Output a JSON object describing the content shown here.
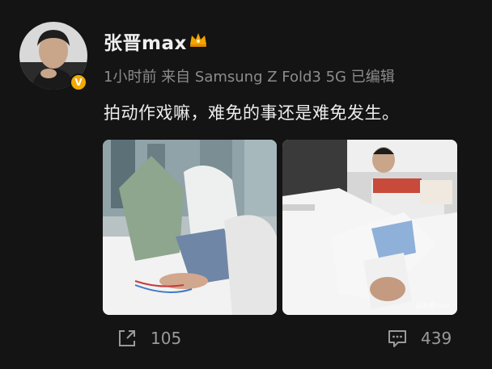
{
  "user": {
    "name": "张晋max",
    "verified_badge": "V"
  },
  "post": {
    "meta": "1小时前 来自 Samsung Z Fold3 5G 已编辑",
    "text": "拍动作戏嘛，难免的事还是难免发生。",
    "photo_watermark": "@张晋max"
  },
  "actions": {
    "share_count": "105",
    "comment_count": "439"
  },
  "icons": [
    "crown-icon",
    "verified-icon",
    "share-icon",
    "comment-icon"
  ],
  "colors": {
    "background": "#141414",
    "text": "#ededed",
    "meta": "#8c8c8c",
    "badge": "#f2a900"
  }
}
